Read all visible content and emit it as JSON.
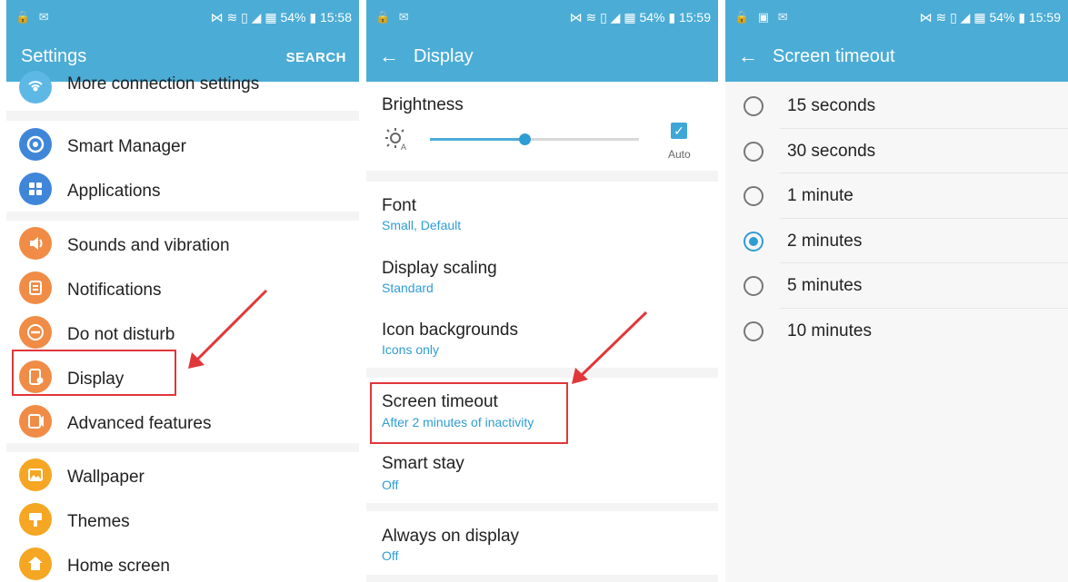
{
  "status": {
    "panel1": {
      "left": "🔒 ✉",
      "right": "⋈ ≋ ▯ ◢ ▦ 54% ▮ 15:58"
    },
    "panel2": {
      "left": "🔒 ✉",
      "right": "⋈ ≋ ▯ ◢ ▦ 54% ▮ 15:59"
    },
    "panel3": {
      "left": "🔒 ▣ ✉",
      "right": "⋈ ≋ ▯ ◢ ▦ 54% ▮ 15:59"
    }
  },
  "settings": {
    "title": "Settings",
    "search": "SEARCH",
    "items": [
      {
        "label": "More connection settings",
        "icon": "wifi-icon"
      },
      {
        "label": "Smart Manager",
        "icon": "smart-manager-icon"
      },
      {
        "label": "Applications",
        "icon": "apps-icon"
      },
      {
        "label": "Sounds and vibration",
        "icon": "volume-icon"
      },
      {
        "label": "Notifications",
        "icon": "notifications-icon"
      },
      {
        "label": "Do not disturb",
        "icon": "do-not-disturb-icon"
      },
      {
        "label": "Display",
        "icon": "display-icon"
      },
      {
        "label": "Advanced features",
        "icon": "advanced-features-icon"
      },
      {
        "label": "Wallpaper",
        "icon": "wallpaper-icon"
      },
      {
        "label": "Themes",
        "icon": "themes-icon"
      },
      {
        "label": "Home screen",
        "icon": "home-icon"
      }
    ]
  },
  "display": {
    "title": "Display",
    "brightness": {
      "label": "Brightness",
      "auto_label": "Auto",
      "value_fraction": 0.45,
      "auto_checked": true
    },
    "items": [
      {
        "label": "Font",
        "sub": "Small, Default"
      },
      {
        "label": "Display scaling",
        "sub": "Standard"
      },
      {
        "label": "Icon backgrounds",
        "sub": "Icons only"
      },
      {
        "label": "Screen timeout",
        "sub": "After 2 minutes of inactivity"
      },
      {
        "label": "Smart stay",
        "sub": "Off"
      },
      {
        "label": "Always on display",
        "sub": "Off"
      }
    ]
  },
  "timeout": {
    "title": "Screen timeout",
    "options": [
      "15 seconds",
      "30 seconds",
      "1 minute",
      "2 minutes",
      "5 minutes",
      "10 minutes"
    ],
    "selected": "2 minutes"
  },
  "colors": {
    "accent": "#4bacd6",
    "highlight": "#e0373a"
  }
}
